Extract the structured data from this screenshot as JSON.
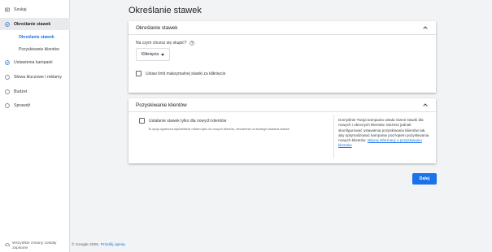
{
  "sidebar": {
    "items": [
      {
        "label": "Szukaj",
        "icon": "search-box-icon"
      },
      {
        "label": "Określanie stawek",
        "icon": "check-circle-icon"
      },
      {
        "label": "Ustawienia kampanii",
        "icon": "check-circle-icon"
      },
      {
        "label": "Słowa kluczowe i reklamy",
        "icon": "circle-outline-icon"
      },
      {
        "label": "Budżet",
        "icon": "circle-outline-icon"
      },
      {
        "label": "Sprawdź",
        "icon": "circle-outline-icon"
      }
    ],
    "subitems": [
      {
        "label": "Określanie stawek"
      },
      {
        "label": "Pozyskiwanie klientów"
      }
    ],
    "footer": "Wszystkie zmiany zostały zapisane"
  },
  "main": {
    "title": "Określanie stawek",
    "bidding_card": {
      "title": "Określanie stawek",
      "question": "Na czym chcesz się skupić?",
      "select_value": "Kliknięcia",
      "checkbox_label": "Ustaw limit maksymalnej stawki za kliknięcie"
    },
    "acquisition_card": {
      "title": "Pozyskiwanie klientów",
      "checkbox_label": "Ustalanie stawek tylko dla nowych klientów",
      "hint": "Ta opcja ogranicza wyświetlanie reklam tylko do nowych klientów, niezależnie od strategii ustalania stawek",
      "info_text": "Domyślnie Twoja kampania ustala równe stawki dla nowych i obecnych klientów. Możesz jednak skonfigurować ustawienia pozyskiwania klientów tak, aby optymalizować kampanię pod kątem pozyskiwania nowych klientów.",
      "info_link": "Więcej informacji o pozyskiwaniu klientów"
    },
    "next_button": "Dalej"
  },
  "footer": {
    "copyright": "© Google 2025.",
    "feedback_link": "Prześlij opinię"
  },
  "colors": {
    "accent": "#1a73e8",
    "active_bg": "#e8eaed",
    "page_bg": "#f1f3f4"
  }
}
